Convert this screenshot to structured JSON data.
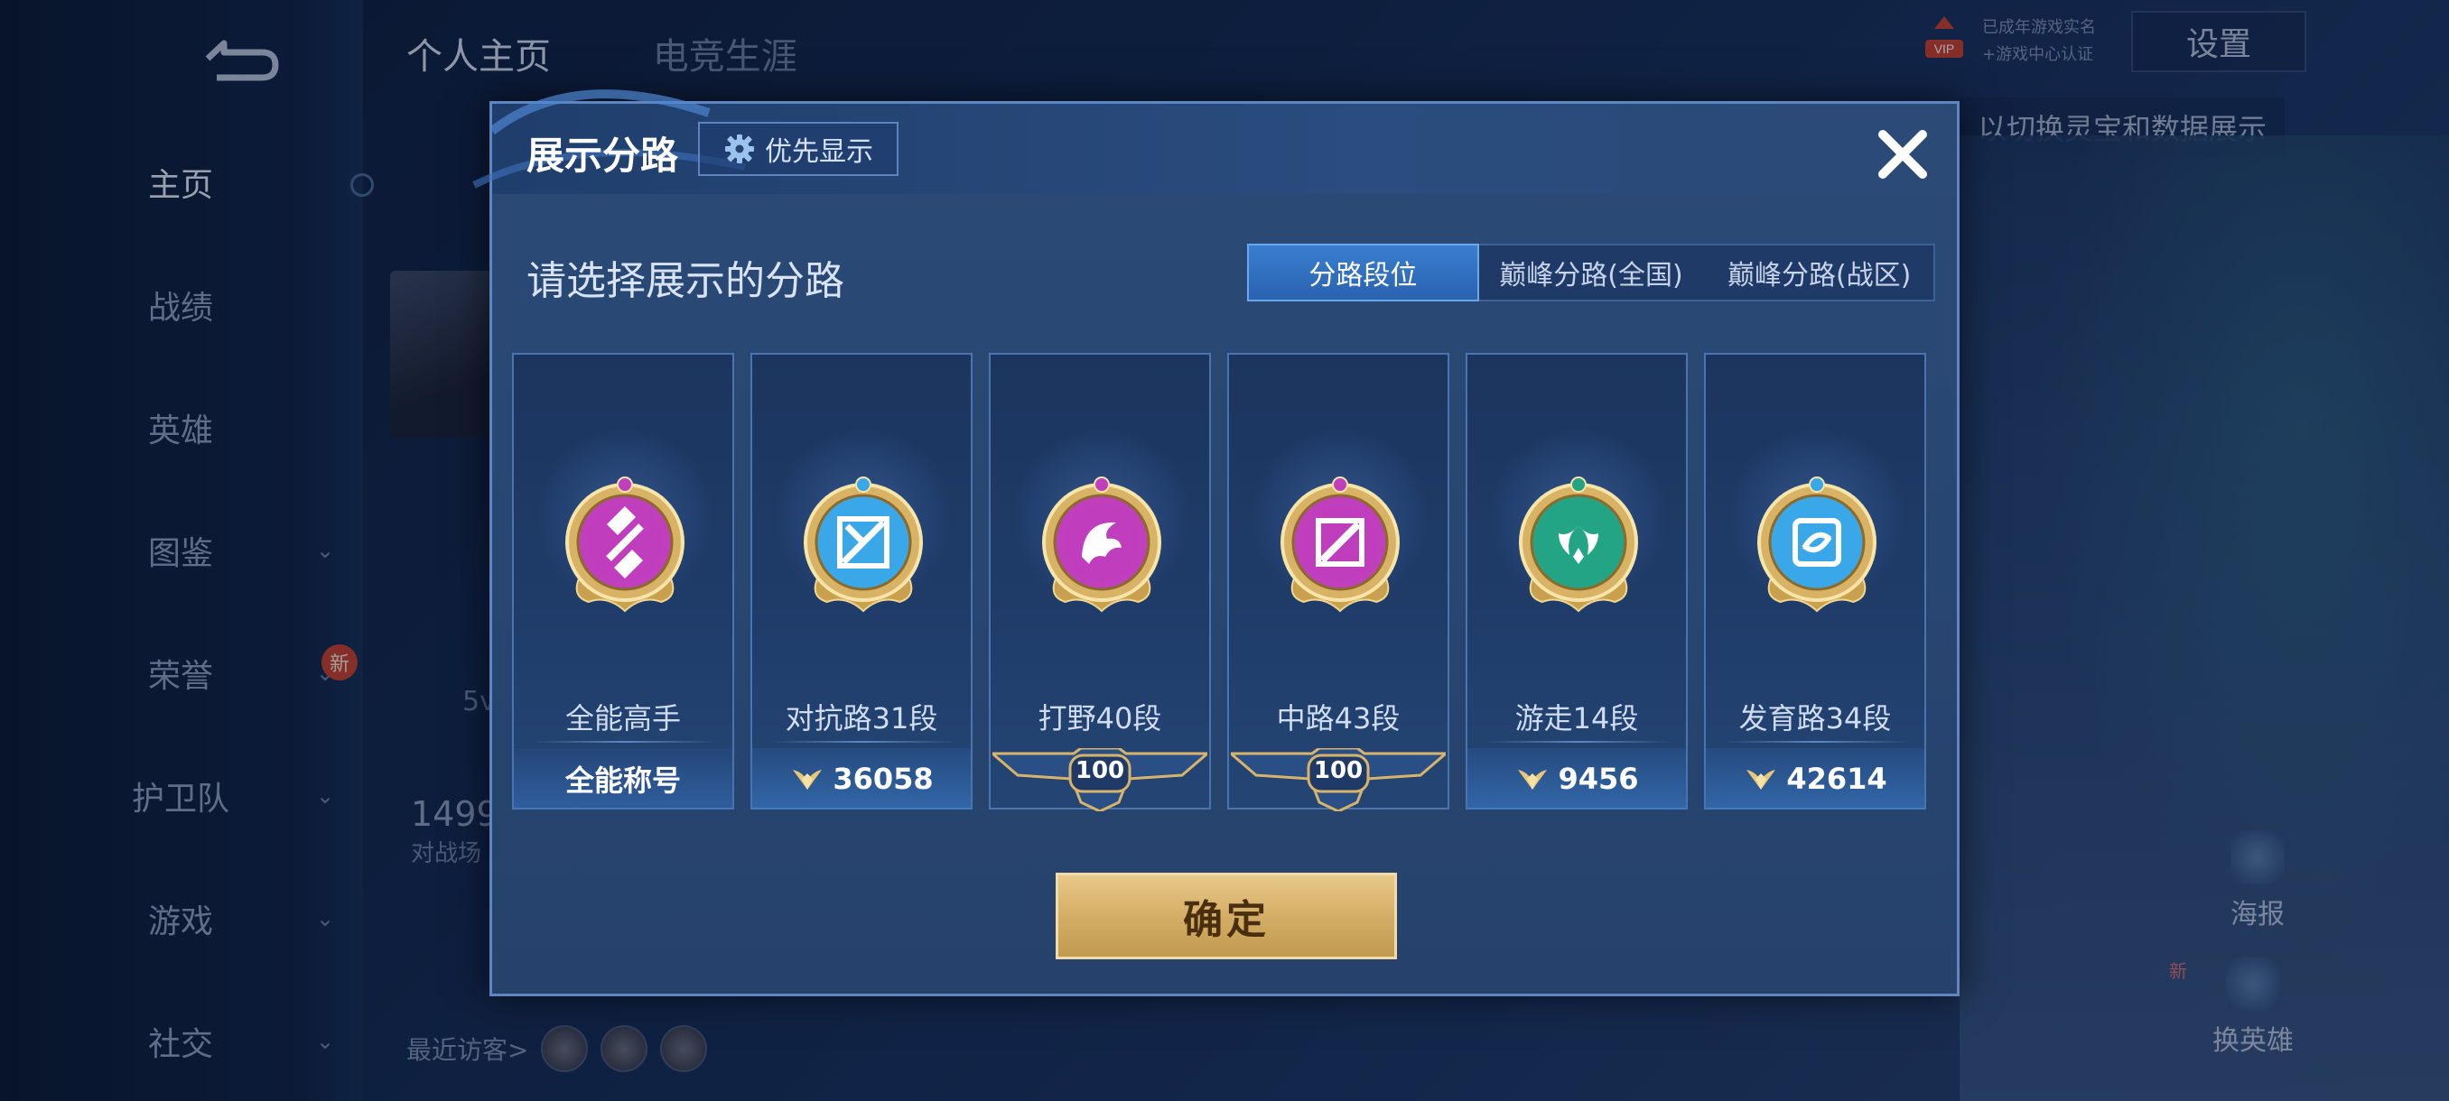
{
  "background": {
    "back_icon": "back-arrow-icon",
    "nav": [
      {
        "label": "主页",
        "active": true,
        "chevron": false,
        "new_badge": ""
      },
      {
        "label": "战绩",
        "active": false,
        "chevron": false,
        "new_badge": ""
      },
      {
        "label": "英雄",
        "active": false,
        "chevron": false,
        "new_badge": ""
      },
      {
        "label": "图鉴",
        "active": false,
        "chevron": true,
        "new_badge": ""
      },
      {
        "label": "荣誉",
        "active": false,
        "chevron": true,
        "new_badge": "新"
      },
      {
        "label": "护卫队",
        "active": false,
        "chevron": true,
        "new_badge": ""
      },
      {
        "label": "游戏",
        "active": false,
        "chevron": true,
        "new_badge": ""
      },
      {
        "label": "社交",
        "active": false,
        "chevron": true,
        "new_badge": ""
      }
    ],
    "top_tabs": [
      "个人主页",
      "电竞生涯"
    ],
    "settings_label": "设置",
    "vip_label": "VIP",
    "vip_small_1": "已成年游戏实名",
    "vip_small_2": "+游戏中心认证",
    "right_hint": "以切换灵宝和数据展示",
    "stat_prefix": "1499",
    "stat_sub": "对战场",
    "mode_label": "5v",
    "visitors_label": "最近访客>",
    "poster_label": "海报",
    "change_hero_label": "换英雄",
    "change_hero_new": "新"
  },
  "modal": {
    "title": "展示分路",
    "priority_label": "优先显示",
    "priority_icon": "gear-icon",
    "close_icon": "close-icon",
    "section_title": "请选择展示的分路",
    "tabs": [
      {
        "label": "分路段位",
        "active": true
      },
      {
        "label": "巅峰分路(全国)",
        "active": false
      },
      {
        "label": "巅峰分路(战区)",
        "active": false
      }
    ],
    "cards": [
      {
        "name": "全能高手",
        "bottom_type": "text",
        "bottom": "全能称号",
        "medal_color": "#c03fbd",
        "glyph": "all-round"
      },
      {
        "name": "对抗路31段",
        "bottom_type": "score",
        "bottom": "36058",
        "medal_color": "#3aa7e8",
        "glyph": "clash"
      },
      {
        "name": "打野40段",
        "bottom_type": "banner",
        "bottom": "100",
        "medal_color": "#c03fbd",
        "glyph": "jungle"
      },
      {
        "name": "中路43段",
        "bottom_type": "banner",
        "bottom": "100",
        "medal_color": "#c03fbd",
        "glyph": "mid"
      },
      {
        "name": "游走14段",
        "bottom_type": "score",
        "bottom": "9456",
        "medal_color": "#23a585",
        "glyph": "roam"
      },
      {
        "name": "发育路34段",
        "bottom_type": "score",
        "bottom": "42614",
        "medal_color": "#3aa7e8",
        "glyph": "farm"
      }
    ],
    "confirm_label": "确定",
    "colors": {
      "gold": "#d4ae66",
      "active_tab": "#2f6fc0"
    }
  }
}
